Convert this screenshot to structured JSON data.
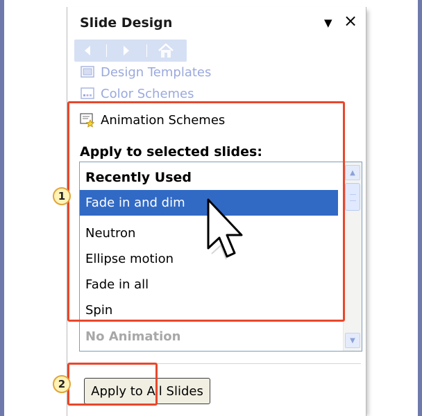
{
  "pane": {
    "title": "Slide Design",
    "dropdown_icon": "triangle-down-icon",
    "close_icon": "close-icon"
  },
  "nav": {
    "back_icon": "arrow-left-icon",
    "forward_icon": "arrow-right-icon",
    "home_icon": "home-icon"
  },
  "links": {
    "design_templates": "Design Templates",
    "color_schemes": "Color Schemes",
    "animation_schemes": "Animation Schemes"
  },
  "apply_label": "Apply to selected slides:",
  "list": {
    "items": [
      {
        "label": "Recently Used",
        "state": "header"
      },
      {
        "label": "Fade in and dim",
        "state": "selected"
      },
      {
        "label": "Neutron",
        "state": "normal"
      },
      {
        "label": "Ellipse motion",
        "state": "normal"
      },
      {
        "label": "Fade in all",
        "state": "normal"
      },
      {
        "label": "Spin",
        "state": "normal"
      },
      {
        "label": "No Animation",
        "state": "disabled"
      }
    ]
  },
  "buttons": {
    "apply_all": "Apply to All Slides"
  },
  "callouts": {
    "one": "1",
    "two": "2"
  },
  "colors": {
    "selection": "#316AC5",
    "highlight": "#E8472B",
    "link": "#9AA9DD",
    "background": "#6F79AC"
  }
}
